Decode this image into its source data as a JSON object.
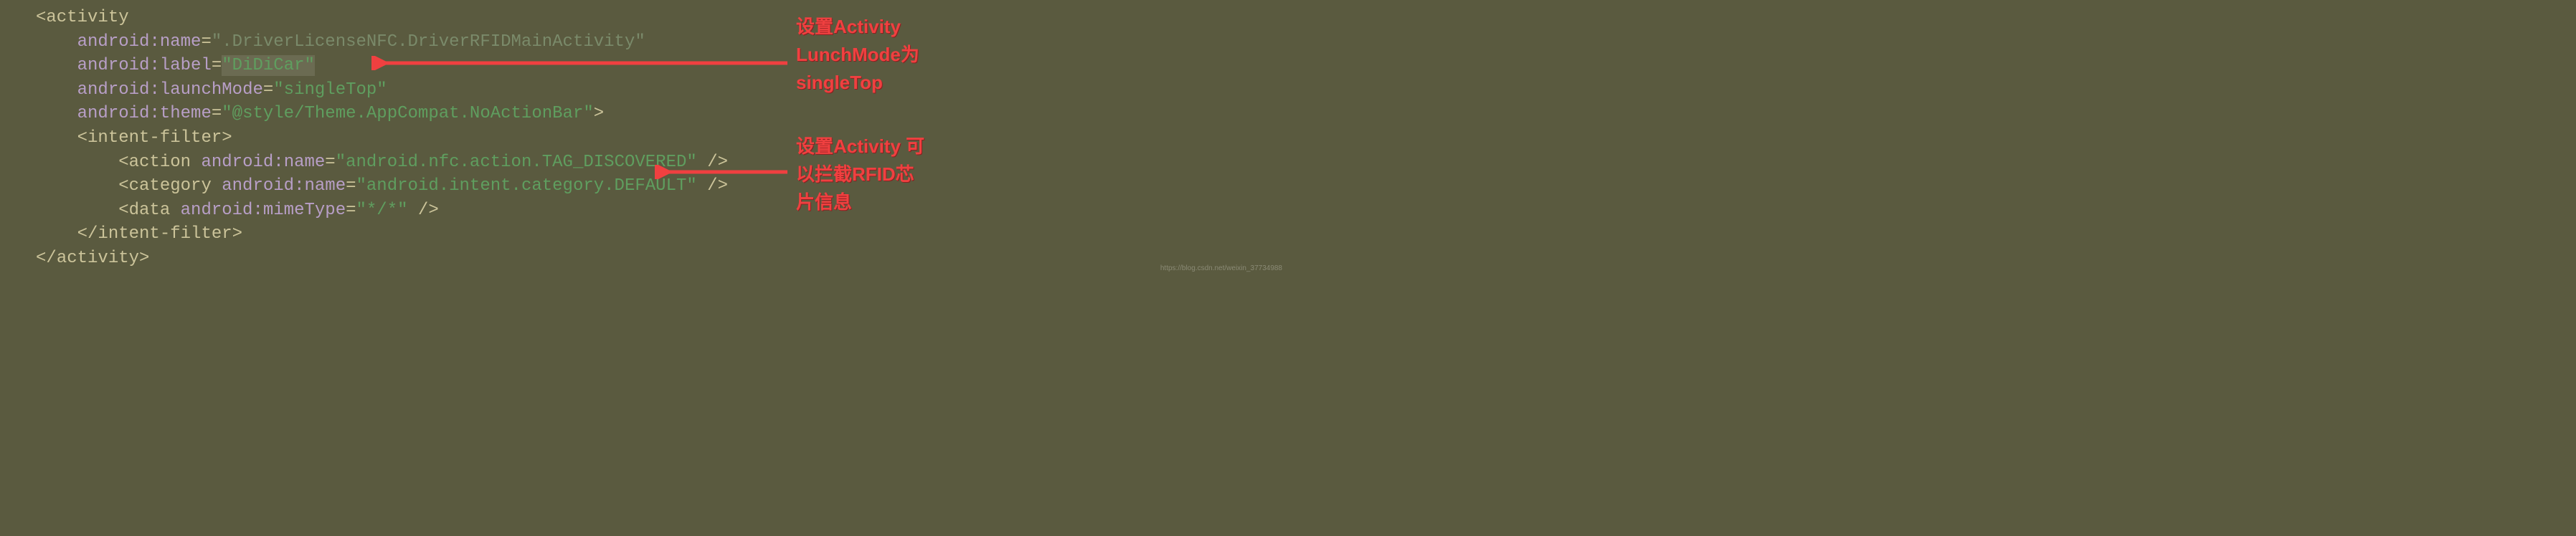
{
  "code": {
    "line1_open": "<",
    "line1_tag": "activity",
    "line2_ns": "android",
    "line2_key": "name",
    "line2_val": "\".DriverLicenseNFC.DriverRFIDMainActivity\"",
    "line3_ns": "android",
    "line3_key": "label",
    "line3_val": "\"DiDiCar\"",
    "line4_ns": "android",
    "line4_key": "launchMode",
    "line4_val": "\"singleTop\"",
    "line5_ns": "android",
    "line5_key": "theme",
    "line5_val": "\"@style/Theme.AppCompat.NoActionBar\"",
    "line5_close": ">",
    "line6_open": "<",
    "line6_tag": "intent-filter",
    "line6_close": ">",
    "line7_open": "<",
    "line7_tag": "action",
    "line7_ns": "android",
    "line7_key": "name",
    "line7_val": "\"android.nfc.action.TAG_DISCOVERED\"",
    "line7_close": " />",
    "line8_open": "<",
    "line8_tag": "category",
    "line8_ns": "android",
    "line8_key": "name",
    "line8_val": "\"android.intent.category.DEFAULT\"",
    "line8_close": " />",
    "line9_open": "<",
    "line9_tag": "data",
    "line9_ns": "android",
    "line9_key": "mimeType",
    "line9_val": "\"*/*\"",
    "line9_close": " />",
    "line10_open": "</",
    "line10_tag": "intent-filter",
    "line10_close": ">",
    "line11_open": "</",
    "line11_tag": "activity",
    "line11_close": ">"
  },
  "annotations": {
    "anno1_line1": "设置Activity",
    "anno1_line2": "LunchMode为",
    "anno1_line3": "singleTop",
    "anno2_line1": "设置Activity 可",
    "anno2_line2": "以拦截RFID芯",
    "anno2_line3": "片信息"
  },
  "watermark": "https://blog.csdn.net/weixin_37734988"
}
